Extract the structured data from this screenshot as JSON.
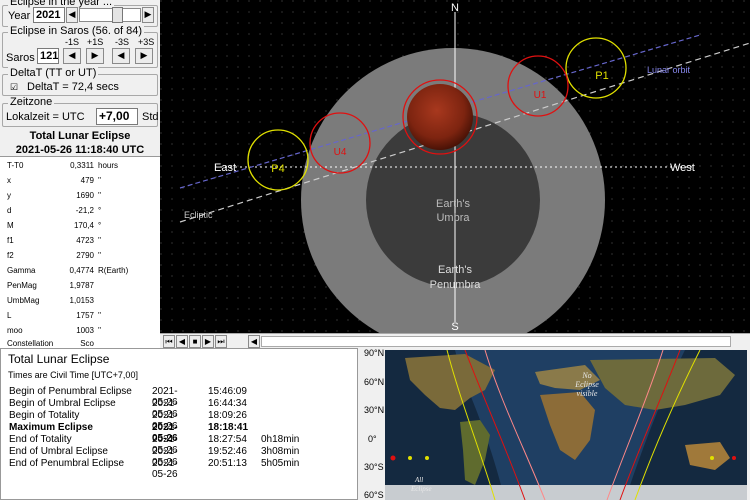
{
  "year_group": {
    "title": "Eclipse in the year ...",
    "label": "Year",
    "value": "2021"
  },
  "saros_group": {
    "title": "Eclipse in Saros (56. of 84)",
    "step_labels": [
      "-1S",
      "+1S",
      "-3S",
      "+3S"
    ],
    "label": "Saros",
    "value": "121"
  },
  "deltat_group": {
    "title": "DeltaT (TT or UT)",
    "checkbox_label": "DeltaT = 72,4 secs",
    "checked": true
  },
  "zone_group": {
    "title": "Zeitzone",
    "label": "Lokalzeit = UTC",
    "value": "+7,00",
    "unit": "Std"
  },
  "eclipse_header": {
    "title": "Total Lunar Eclipse",
    "datetime": "2021-05-26  11:18:40 UTC"
  },
  "params": [
    {
      "k": "T-T0",
      "v": "0,3311",
      "u": "hours"
    },
    {
      "k": "x",
      "v": "479",
      "u": "''"
    },
    {
      "k": "y",
      "v": "1690",
      "u": "''"
    },
    {
      "k": "d",
      "v": "-21,2",
      "u": "°"
    },
    {
      "k": "M",
      "v": "170,4",
      "u": "°"
    },
    {
      "k": "f1",
      "v": "4723",
      "u": "''"
    },
    {
      "k": "f2",
      "v": "2790",
      "u": "''"
    },
    {
      "k": "Gamma",
      "v": "0,4774",
      "u": "R(Earth)"
    },
    {
      "k": "PenMag",
      "v": "1,9787",
      "u": ""
    },
    {
      "k": "UmbMag",
      "v": "1,0153",
      "u": ""
    },
    {
      "k": "L",
      "v": "1757",
      "u": "''"
    },
    {
      "k": "moo",
      "v": "1003",
      "u": "''"
    },
    {
      "k": "Constellation",
      "v": "Sco",
      "u": ""
    }
  ],
  "sky": {
    "north": "N",
    "south": "S",
    "east": "East",
    "west": "West",
    "lunar_orbit": "Lunar orbit",
    "ecliptic": "Ecliptic",
    "umbra": [
      "Earth's",
      "Umbra"
    ],
    "penumbra": [
      "Earth's",
      "Penumbra"
    ],
    "positions": [
      "P1",
      "U1",
      "U4",
      "P4"
    ]
  },
  "controls": [
    "⏮",
    "◀",
    "■",
    "▶",
    "⏭",
    "◀"
  ],
  "report": {
    "title": "Total Lunar Eclipse",
    "subtitle": "Times are Civil Time [UTC+7,00]",
    "rows": [
      {
        "label": "Begin of Penumbral Eclipse",
        "date": "2021-05-26",
        "time": "15:46:09",
        "dur": "",
        "bold": false
      },
      {
        "label": "Begin of Umbral Eclipse",
        "date": "2021-05-26",
        "time": "16:44:34",
        "dur": "",
        "bold": false
      },
      {
        "label": "Begin of Totality",
        "date": "2021-05-26",
        "time": "18:09:26",
        "dur": "",
        "bold": false
      },
      {
        "label": "Maximum Eclipse",
        "date": "2021-05-26",
        "time": "18:18:41",
        "dur": "",
        "bold": true
      },
      {
        "label": "End of Totality",
        "date": "2021-05-26",
        "time": "18:27:54",
        "dur": "0h18min",
        "bold": false
      },
      {
        "label": "End of Umbral Eclipse",
        "date": "2021-05-26",
        "time": "19:52:46",
        "dur": "3h08min",
        "bold": false
      },
      {
        "label": "End of Penumbral Eclipse",
        "date": "2021-05-26",
        "time": "20:51:13",
        "dur": "5h05min",
        "bold": false
      }
    ]
  },
  "map": {
    "lat_labels": [
      "90°N",
      "60°N",
      "30°N",
      "0°",
      "30°S",
      "60°S"
    ],
    "texts": [
      "No",
      "Eclipse",
      "visible",
      "All",
      "Eclipse"
    ]
  },
  "colors": {
    "moon": "#8b2a14",
    "umbra": "#3a3a3a",
    "penumbra": "#7a7a7a",
    "orbit": "#6666cc",
    "yellow": "#e0e000",
    "red": "#e01010"
  }
}
